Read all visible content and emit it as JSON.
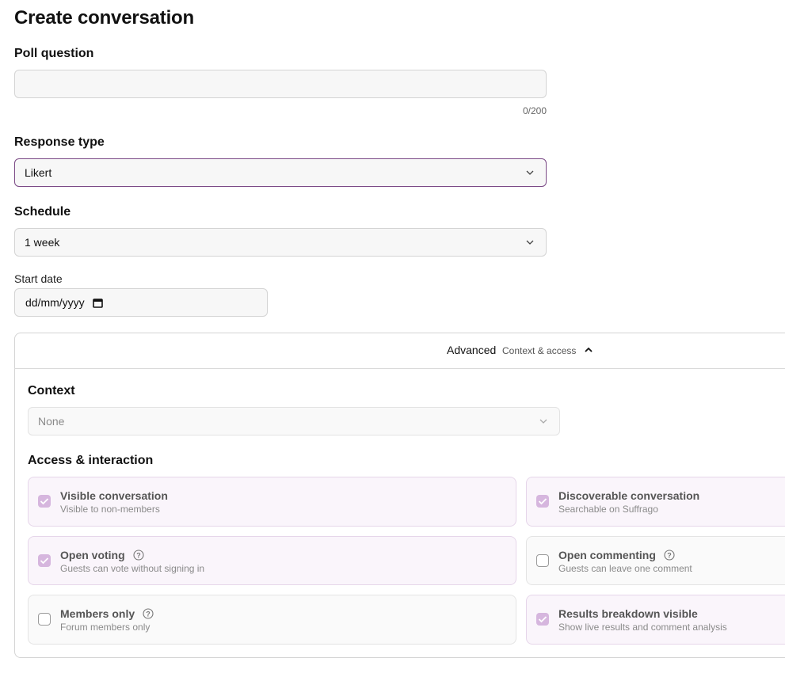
{
  "page": {
    "title": "Create conversation"
  },
  "poll": {
    "label": "Poll question",
    "value": "",
    "counter": "0/200"
  },
  "response": {
    "label": "Response type",
    "value": "Likert"
  },
  "schedule": {
    "label": "Schedule",
    "value": "1 week"
  },
  "start": {
    "label": "Start date",
    "placeholder": "dd/mm/yyyy"
  },
  "advanced": {
    "title": "Advanced",
    "subtitle": "Context & access",
    "context_label": "Context",
    "context_value": "None",
    "access_label": "Access & interaction"
  },
  "options": [
    {
      "title": "Visible conversation",
      "subtitle": "Visible to non-members",
      "checked": true,
      "help": false
    },
    {
      "title": "Discoverable conversation",
      "subtitle": "Searchable on Suffrago",
      "checked": true,
      "help": false
    },
    {
      "title": "Open voting",
      "subtitle": "Guests can vote without signing in",
      "checked": true,
      "help": true
    },
    {
      "title": "Open commenting",
      "subtitle": "Guests can leave one comment",
      "checked": false,
      "help": true
    },
    {
      "title": "Members only",
      "subtitle": "Forum members only",
      "checked": false,
      "help": true
    },
    {
      "title": "Results breakdown visible",
      "subtitle": "Show live results and comment analysis",
      "checked": true,
      "help": false
    }
  ],
  "colors": {
    "accent": "#7b4a86",
    "checked_fill": "#d6b6de",
    "option_bg": "#faf5fb"
  },
  "icons": [
    "chevron-down-icon",
    "chevron-up-icon",
    "calendar-icon",
    "check-icon",
    "help-circle-icon"
  ]
}
